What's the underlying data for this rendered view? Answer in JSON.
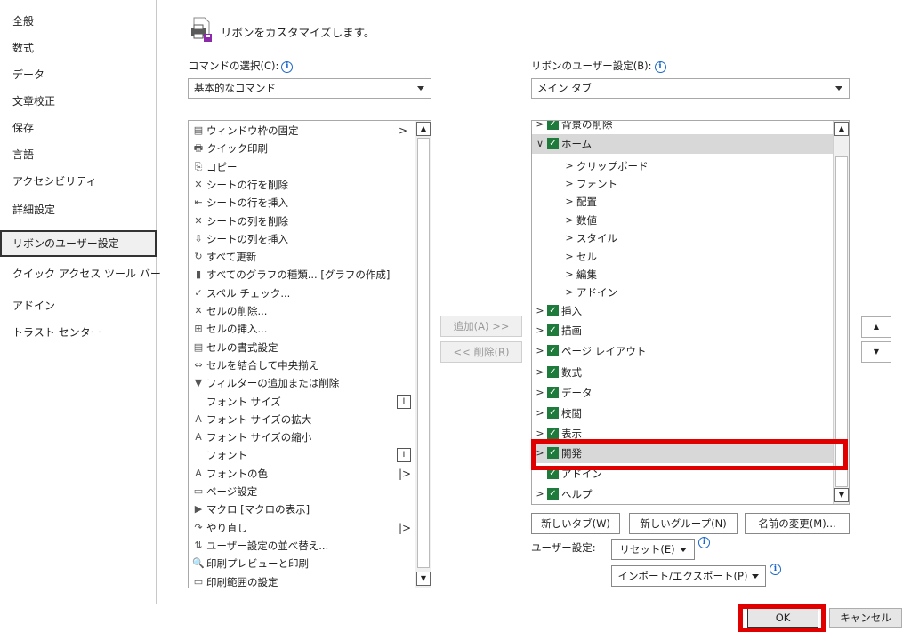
{
  "nav": {
    "items": [
      {
        "label": "全般"
      },
      {
        "label": "数式"
      },
      {
        "label": "データ"
      },
      {
        "label": "文章校正"
      },
      {
        "label": "保存"
      },
      {
        "label": "言語"
      },
      {
        "label": "アクセシビリティ"
      },
      {
        "label": "詳細設定"
      },
      {
        "label": "リボンのユーザー設定"
      },
      {
        "label": "クイック アクセス ツール バー"
      },
      {
        "label": "アドイン"
      },
      {
        "label": "トラスト センター"
      }
    ],
    "selected": "リボンのユーザー設定"
  },
  "header": {
    "title": "リボンをカスタマイズします。"
  },
  "commands": {
    "label": "コマンドの選択(C):",
    "dropdown_value": "基本的なコマンド",
    "items": [
      {
        "icon": "freeze-panes-icon",
        "glyph": "▤",
        "label": "ウィンドウ枠の固定",
        "right": ">"
      },
      {
        "icon": "quick-print-icon",
        "glyph": "🖶",
        "label": "クイック印刷",
        "right": ""
      },
      {
        "icon": "copy-icon",
        "glyph": "⎘",
        "label": "コピー",
        "right": ""
      },
      {
        "icon": "delete-row-icon",
        "glyph": "✕",
        "label": "シートの行を削除",
        "right": ""
      },
      {
        "icon": "insert-row-icon",
        "glyph": "⇤",
        "label": "シートの行を挿入",
        "right": ""
      },
      {
        "icon": "delete-column-icon",
        "glyph": "✕",
        "label": "シートの列を削除",
        "right": ""
      },
      {
        "icon": "insert-column-icon",
        "glyph": "⇩",
        "label": "シートの列を挿入",
        "right": ""
      },
      {
        "icon": "refresh-all-icon",
        "glyph": "↻",
        "label": "すべて更新",
        "right": ""
      },
      {
        "icon": "chart-type-icon",
        "glyph": "▮",
        "label": "すべてのグラフの種類... [グラフの作成]",
        "right": ""
      },
      {
        "icon": "spelling-icon",
        "glyph": "✓",
        "label": "スペル チェック...",
        "right": ""
      },
      {
        "icon": "delete-cell-icon",
        "glyph": "✕",
        "label": "セルの削除...",
        "right": ""
      },
      {
        "icon": "insert-cell-icon",
        "glyph": "⊞",
        "label": "セルの挿入...",
        "right": ""
      },
      {
        "icon": "format-cells-icon",
        "glyph": "▤",
        "label": "セルの書式設定",
        "right": ""
      },
      {
        "icon": "merge-center-icon",
        "glyph": "⇔",
        "label": "セルを結合して中央揃え",
        "right": ""
      },
      {
        "icon": "filter-icon",
        "glyph": "▼",
        "label": "フィルターの追加または削除",
        "right": ""
      },
      {
        "icon": "",
        "glyph": "",
        "label": "フォント サイズ",
        "right": "box"
      },
      {
        "icon": "font-grow-icon",
        "glyph": "A",
        "label": "フォント サイズの拡大",
        "right": ""
      },
      {
        "icon": "font-shrink-icon",
        "glyph": "A",
        "label": "フォント サイズの縮小",
        "right": ""
      },
      {
        "icon": "",
        "glyph": "",
        "label": "フォント",
        "right": "box"
      },
      {
        "icon": "font-color-icon",
        "glyph": "A",
        "label": "フォントの色",
        "right": "|>"
      },
      {
        "icon": "page-setup-icon",
        "glyph": "▭",
        "label": "ページ設定",
        "right": ""
      },
      {
        "icon": "macro-icon",
        "glyph": "▶",
        "label": "マクロ [マクロの表示]",
        "right": ""
      },
      {
        "icon": "redo-icon",
        "glyph": "↷",
        "label": "やり直し",
        "right": "|>"
      },
      {
        "icon": "custom-sort-icon",
        "glyph": "⇅",
        "label": "ユーザー設定の並べ替え...",
        "right": ""
      },
      {
        "icon": "print-preview-icon",
        "glyph": "🔍",
        "label": "印刷プレビューと印刷",
        "right": ""
      },
      {
        "icon": "print-area-icon",
        "glyph": "▭",
        "label": "印刷範囲の設定",
        "right": ""
      }
    ]
  },
  "ribbon": {
    "label": "リボンのユーザー設定(B):",
    "dropdown_value": "メイン タブ",
    "tree": [
      {
        "level": 0,
        "chevron": ">",
        "checked": true,
        "label": "背景の削除",
        "hl": false
      },
      {
        "level": 0,
        "chevron": "∨",
        "checked": true,
        "label": "ホーム",
        "hl": true
      },
      {
        "level": 1,
        "chevron": ">",
        "checked": false,
        "label": "クリップボード",
        "hl": false
      },
      {
        "level": 1,
        "chevron": ">",
        "checked": false,
        "label": "フォント",
        "hl": false
      },
      {
        "level": 1,
        "chevron": ">",
        "checked": false,
        "label": "配置",
        "hl": false
      },
      {
        "level": 1,
        "chevron": ">",
        "checked": false,
        "label": "数値",
        "hl": false
      },
      {
        "level": 1,
        "chevron": ">",
        "checked": false,
        "label": "スタイル",
        "hl": false
      },
      {
        "level": 1,
        "chevron": ">",
        "checked": false,
        "label": "セル",
        "hl": false
      },
      {
        "level": 1,
        "chevron": ">",
        "checked": false,
        "label": "編集",
        "hl": false
      },
      {
        "level": 1,
        "chevron": ">",
        "checked": false,
        "label": "アドイン",
        "hl": false
      },
      {
        "level": 0,
        "chevron": ">",
        "checked": true,
        "label": "挿入",
        "hl": false
      },
      {
        "level": 0,
        "chevron": ">",
        "checked": true,
        "label": "描画",
        "hl": false
      },
      {
        "level": 0,
        "chevron": ">",
        "checked": true,
        "label": "ページ レイアウト",
        "hl": false
      },
      {
        "level": 0,
        "chevron": ">",
        "checked": true,
        "label": "数式",
        "hl": false
      },
      {
        "level": 0,
        "chevron": ">",
        "checked": true,
        "label": "データ",
        "hl": false
      },
      {
        "level": 0,
        "chevron": ">",
        "checked": true,
        "label": "校閲",
        "hl": false
      },
      {
        "level": 0,
        "chevron": ">",
        "checked": true,
        "label": "表示",
        "hl": false
      },
      {
        "level": 0,
        "chevron": ">",
        "checked": true,
        "label": "開発",
        "hl": true
      },
      {
        "level": 0,
        "chevron": "",
        "checked": true,
        "label": "アドイン",
        "hl": false
      },
      {
        "level": 0,
        "chevron": ">",
        "checked": true,
        "label": "ヘルプ",
        "hl": false
      }
    ],
    "new_tab": "新しいタブ(W)",
    "new_group": "新しいグループ(N)",
    "rename": "名前の変更(M)...",
    "custom_label": "ユーザー設定:",
    "reset": "リセット(E)",
    "import_export": "インポート/エクスポート(P)"
  },
  "buttons": {
    "add": "追加(A) >>",
    "remove": "<< 削除(R)",
    "move_up": "▲",
    "move_down": "▼",
    "ok": "OK",
    "cancel": "キャンセル"
  },
  "info_glyph": "i",
  "scroll": {
    "up": "▲",
    "down": "▼"
  },
  "colors": {
    "checkbox": "#1e7b3c",
    "highlight": "#e00000",
    "selected_row": "#d8d8d8"
  }
}
